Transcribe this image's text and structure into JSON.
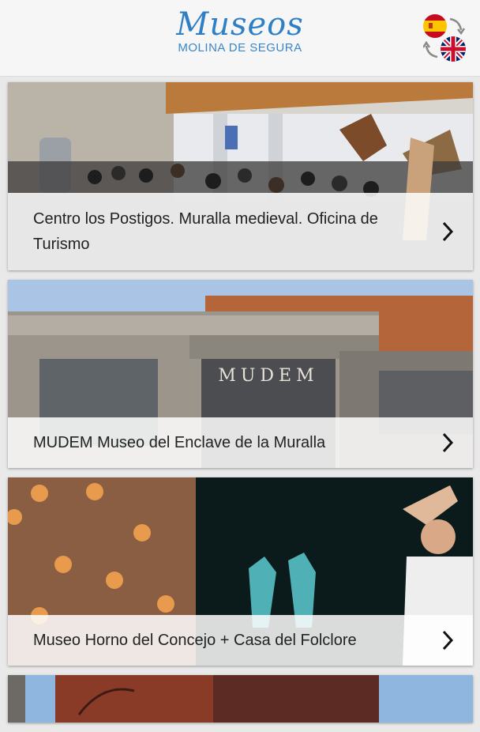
{
  "header": {
    "logo_script": "Museos",
    "logo_sub": "MOLINA DE SEGURA",
    "languages": [
      "es-flag-icon",
      "uk-flag-icon"
    ]
  },
  "museums": [
    {
      "title": "Centro los Postigos. Muralla medieval. Oficina de Turismo"
    },
    {
      "title": "MUDEM Museo del Enclave de la Muralla",
      "sign": "MUDEM"
    },
    {
      "title": "Museo Horno del Concejo + Casa del Folclore"
    }
  ],
  "colors": {
    "brand": "#2f7fc4",
    "header_bg": "#f6f6f6",
    "page_bg": "#e9e9e9"
  }
}
